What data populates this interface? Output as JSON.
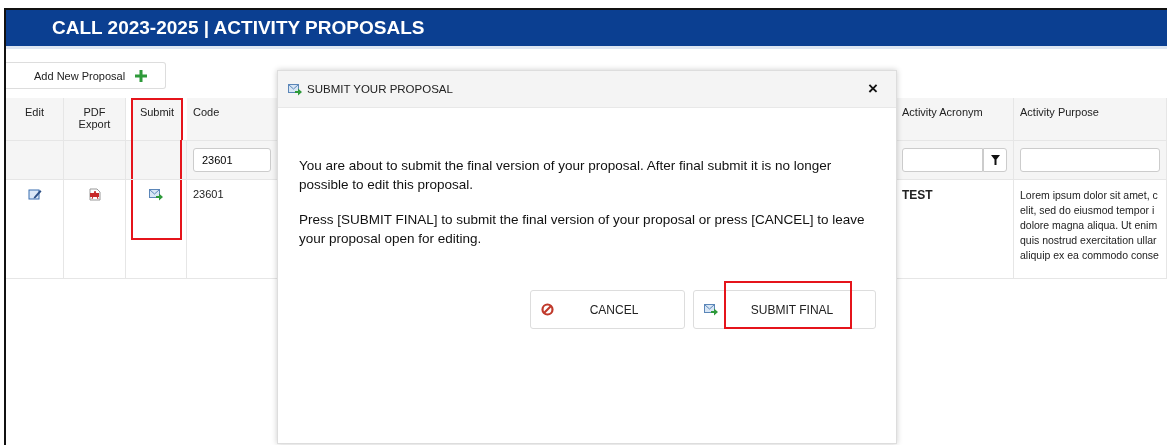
{
  "header": {
    "title": "CALL 2023-2025 | ACTIVITY PROPOSALS"
  },
  "toolbar": {
    "add_button": "Add New Proposal"
  },
  "table": {
    "columns": [
      "Edit",
      "PDF Export",
      "Submit",
      "Code",
      "Activity Acronym",
      "Activity Purpose"
    ],
    "filters": {
      "code": "23601"
    },
    "rows": [
      {
        "code": "23601",
        "acronym": "TEST",
        "purpose_lines": [
          "Lorem ipsum dolor sit amet, c",
          "elit, sed do eiusmod tempor i",
          "dolore magna aliqua. Ut enim",
          "quis nostrud exercitation ullar",
          "aliquip ex ea commodo conse"
        ]
      }
    ]
  },
  "dialog": {
    "title": "SUBMIT YOUR PROPOSAL",
    "close": "×",
    "paragraphs": [
      "You are about to submit the final version of your proposal. After final submit it is no longer possible to edit this proposal.",
      "Press [SUBMIT FINAL] to submit the final version of your proposal or press [CANCEL] to leave your proposal open for editing."
    ],
    "buttons": [
      {
        "label": "CANCEL",
        "kind": "cancel"
      },
      {
        "label": "SUBMIT FINAL",
        "kind": "submit"
      }
    ]
  }
}
